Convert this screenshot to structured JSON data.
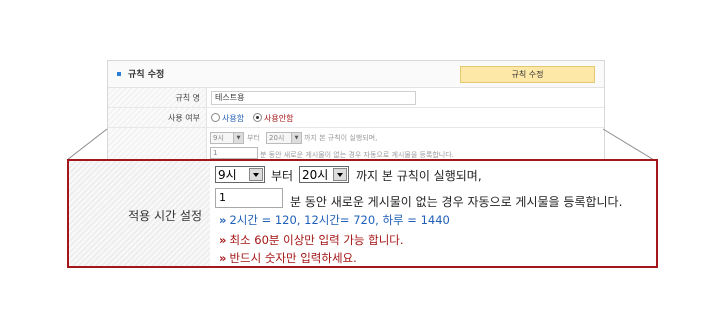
{
  "header": {
    "title": "규칙 수정",
    "button_label": "규칙 수정"
  },
  "rule_name": {
    "label": "규칙 명",
    "value": "테스트용"
  },
  "usage": {
    "label": "사용 여부",
    "options": [
      "사용함",
      "사용안함"
    ],
    "selected": "사용안함"
  },
  "background_schedule": {
    "hour_from": "9시",
    "from_text": "부터",
    "hour_to": "20시",
    "until_text": "까지 본 규칙이 실행되며,",
    "minutes": "1",
    "minutes_text": "분 동안 새로운 게시물이 없는 경우 자동으로 게시물을 등록합니다."
  },
  "callout": {
    "label": "적용 시간 설정",
    "hour_from": "9시",
    "from_text": "부터",
    "hour_to": "20시",
    "until_text": "까지 본 규칙이 실행되며,",
    "minutes": "1",
    "minutes_text": "분 동안 새로운 게시물이 없는 경우 자동으로 게시물을 등록합니다.",
    "notes": [
      {
        "mark": "»",
        "text": "2시간 = 120, 12시간= 720, 하루 = 1440",
        "color": "#1f5fb8"
      },
      {
        "mark": "»",
        "text": "최소 60분 이상만 입력 가능 합니다.",
        "color": "#a41414"
      },
      {
        "mark": "»",
        "text": "반드시 숫자만 입력하세요.",
        "color": "#a41414"
      }
    ]
  },
  "colors": {
    "callout_border": "#a4161a",
    "header_button_bg": "#fde8a8",
    "accent_blue": "#2a7fd4"
  }
}
